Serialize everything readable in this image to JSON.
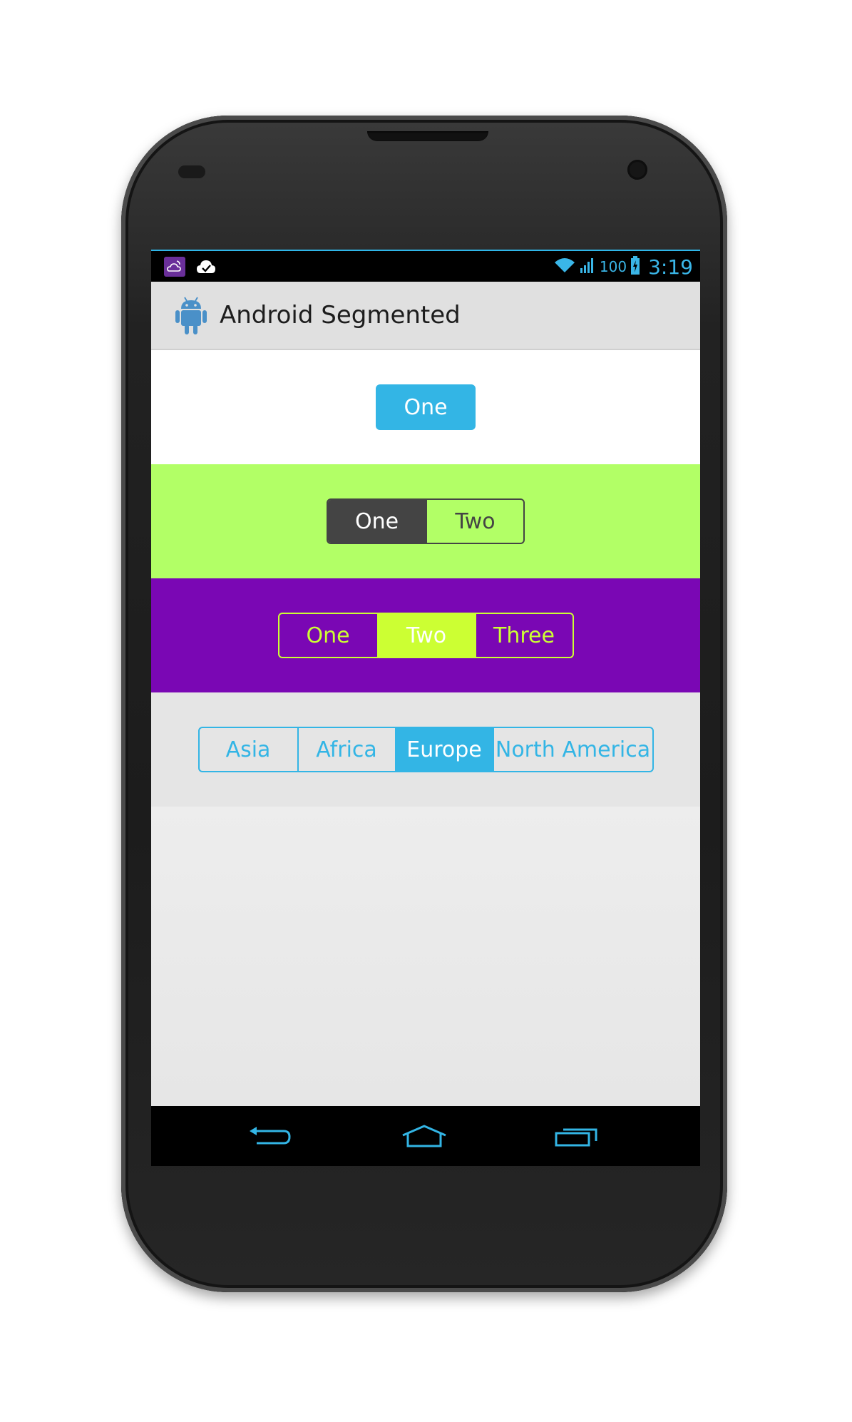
{
  "status_bar": {
    "battery_level": "100",
    "time": "3:19",
    "notification_icons": [
      "weather-icon",
      "check-cloud-icon"
    ],
    "system_icons": [
      "wifi-icon",
      "signal-icon",
      "battery-charging-icon"
    ]
  },
  "action_bar": {
    "title": "Android Segmented",
    "icon": "android-robot-icon"
  },
  "segmented_1": {
    "background": "#ffffff",
    "accent": "#33b5e5",
    "items": [
      {
        "label": "One",
        "selected": true
      }
    ]
  },
  "segmented_2": {
    "background": "#b2ff66",
    "accent": "#444444",
    "items": [
      {
        "label": "One",
        "selected": true
      },
      {
        "label": "Two",
        "selected": false
      }
    ]
  },
  "segmented_3": {
    "background": "#7a07b4",
    "accent": "#ccff33",
    "items": [
      {
        "label": "One",
        "selected": false
      },
      {
        "label": "Two",
        "selected": true
      },
      {
        "label": "Three",
        "selected": false
      }
    ]
  },
  "segmented_4": {
    "background": "#e5e5e5",
    "accent": "#33b5e5",
    "items": [
      {
        "label": "Asia",
        "selected": false
      },
      {
        "label": "Africa",
        "selected": false
      },
      {
        "label": "Europe",
        "selected": true
      },
      {
        "label": "North America",
        "selected": false
      }
    ]
  },
  "nav_bar": {
    "buttons": [
      "back-icon",
      "home-icon",
      "recent-apps-icon"
    ]
  }
}
